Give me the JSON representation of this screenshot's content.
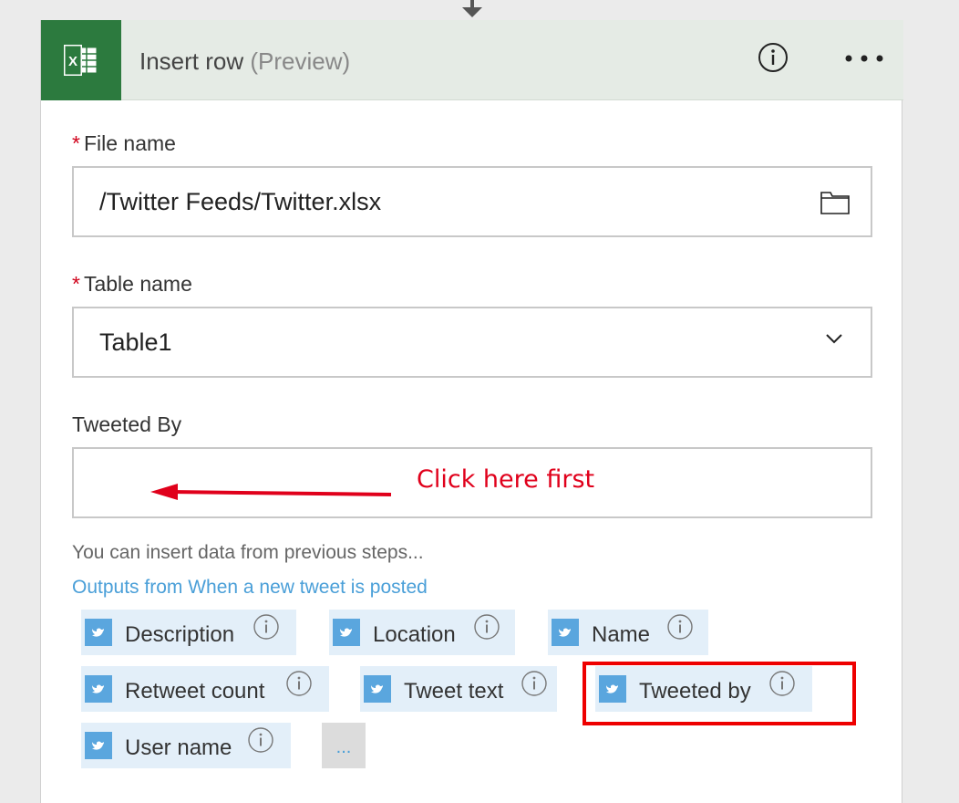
{
  "header": {
    "title": "Insert row",
    "preview": "(Preview)",
    "app_icon": "excel-icon",
    "info_icon": "info-icon",
    "more_icon": "more-icon"
  },
  "fields": {
    "file_name": {
      "required_mark": "*",
      "label": "File name",
      "value": "/Twitter Feeds/Twitter.xlsx",
      "icon": "folder-icon"
    },
    "table_name": {
      "required_mark": "*",
      "label": "Table name",
      "value": "Table1",
      "icon": "chevron-down-icon"
    },
    "tweeted_by": {
      "label": "Tweeted By",
      "value": ""
    }
  },
  "help_text": "You can insert data from previous steps...",
  "outputs_link": "Outputs from When a new tweet is posted",
  "tokens": [
    {
      "label": "Description"
    },
    {
      "label": "Location"
    },
    {
      "label": "Name"
    },
    {
      "label": "Retweet count"
    },
    {
      "label": "Tweet text"
    },
    {
      "label": "Tweeted by"
    },
    {
      "label": "User name"
    }
  ],
  "more_tokens_label": "...",
  "annotation": {
    "text": "Click here first",
    "color": "#e0001b"
  },
  "colors": {
    "excel_green": "#2c7a3e",
    "twitter_blue": "#5aa6de",
    "token_bg": "#e3eff9",
    "link_blue": "#4a9fd8",
    "highlight_red": "#ee0000"
  }
}
